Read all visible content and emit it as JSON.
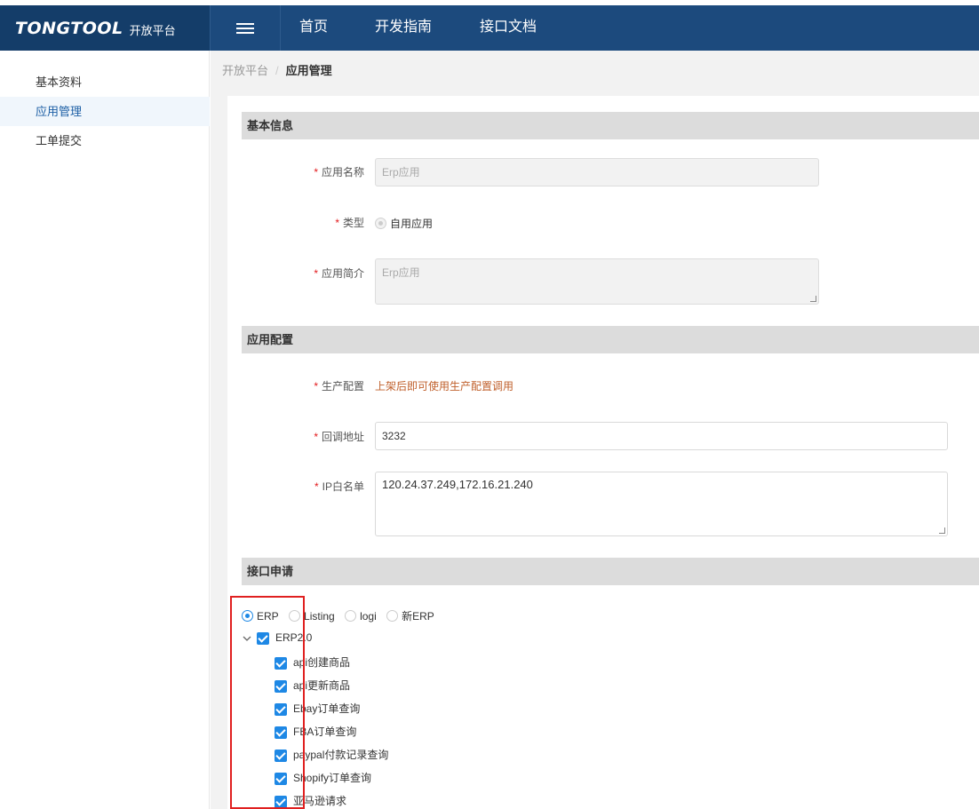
{
  "topbar": {
    "brand_name": "TONGTOOL",
    "brand_sub": "开放平台",
    "nav": [
      "首页",
      "开发指南",
      "接口文档"
    ]
  },
  "sidebar": {
    "items": [
      {
        "label": "基本资料"
      },
      {
        "label": "应用管理"
      },
      {
        "label": "工单提交"
      }
    ]
  },
  "breadcrumb": {
    "root": "开放平台",
    "separator": "/",
    "current": "应用管理"
  },
  "basic_info": {
    "title": "基本信息",
    "app_name": {
      "label": "应用名称",
      "placeholder": "Erp应用"
    },
    "type": {
      "label": "类型",
      "option": "自用应用"
    },
    "intro": {
      "label": "应用简介",
      "placeholder": "Erp应用"
    }
  },
  "app_config": {
    "title": "应用配置",
    "prod": {
      "label": "生产配置",
      "note": "上架后即可使用生产配置调用"
    },
    "callback": {
      "label": "回调地址",
      "value": "3232"
    },
    "ip_whitelist": {
      "label": "IP白名单",
      "value": "120.24.37.249,172.16.21.240"
    }
  },
  "api_request": {
    "title": "接口申请",
    "types": [
      "ERP",
      "Listing",
      "logi",
      "新ERP"
    ],
    "selected_type": "ERP",
    "group": "ERP2.0",
    "items": [
      "api创建商品",
      "api更新商品",
      "Ebay订单查询",
      "FBA订单查询",
      "paypal付款记录查询",
      "Shopify订单查询",
      "亚马逊请求"
    ]
  },
  "required_mark": "*",
  "colors": {
    "header": "#1c4a7d",
    "accent": "#1e88e5",
    "required": "#e3191c",
    "highlight_box": "#e02020"
  }
}
